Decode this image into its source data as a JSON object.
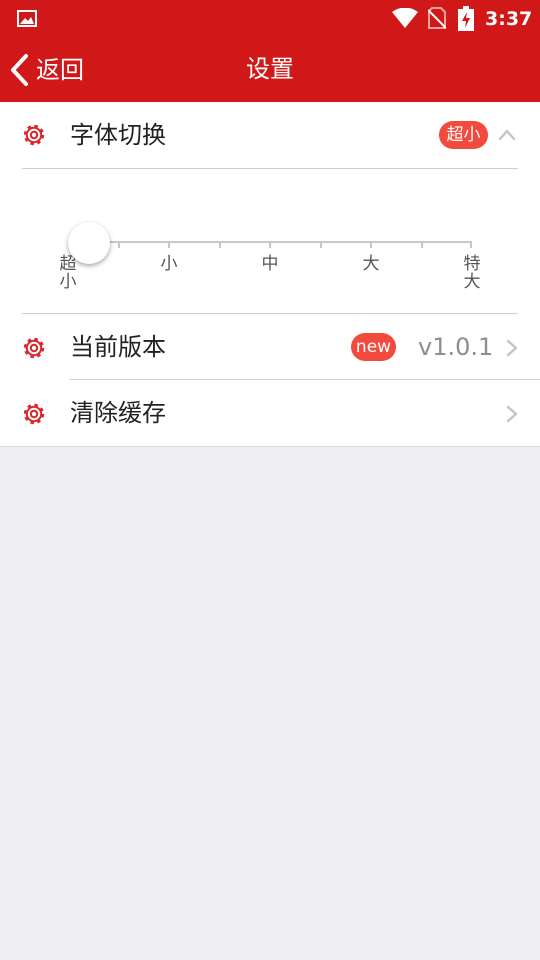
{
  "status_bar": {
    "time": "3:37",
    "icons": [
      "image-icon",
      "wifi-icon",
      "no-sim-icon",
      "battery-charging-icon"
    ]
  },
  "nav": {
    "back_label": "返回",
    "title": "设置"
  },
  "settings": {
    "font_switch": {
      "label": "字体切换",
      "badge": "超小",
      "expanded": true,
      "options": [
        "超小",
        "小",
        "中",
        "大",
        "特大"
      ],
      "selected_index": 0
    },
    "version": {
      "label": "当前版本",
      "badge": "new",
      "value": "v1.0.1"
    },
    "clear_cache": {
      "label": "清除缓存"
    }
  },
  "colors": {
    "primary_red": "#d11818",
    "badge_red": "#f24a3c",
    "gear_red": "#d9262c",
    "background": "#efeef3"
  }
}
